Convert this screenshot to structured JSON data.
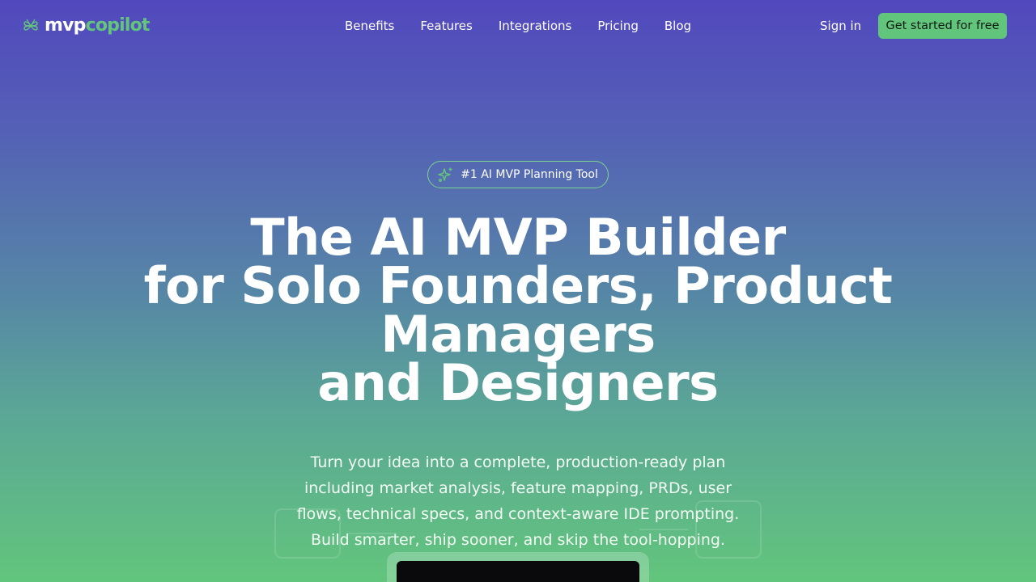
{
  "brand": {
    "name_part1": "mvp",
    "name_part2": "copilot"
  },
  "nav": {
    "links": [
      "Benefits",
      "Features",
      "Integrations",
      "Pricing",
      "Blog"
    ],
    "signin_label": "Sign in",
    "cta_label": "Get started for free"
  },
  "hero": {
    "badge_text": "#1 AI MVP Planning Tool",
    "headline_lines": [
      "The AI MVP Builder",
      "for Solo Founders, Product",
      "Managers",
      "and Designers"
    ],
    "subtext_lines": [
      "Turn your idea into a complete, production-ready plan",
      "including market analysis, feature mapping, PRDs, user",
      "flows, technical specs, and context-aware IDE prompting.",
      "Build smarter, ship sooner, and skip the tool-hopping."
    ]
  },
  "icons": {
    "logo": "clover-logo-icon",
    "badge": "sparkles-icon"
  },
  "colors": {
    "accent_green": "#62c57c",
    "gradient_top": "#5248bd",
    "gradient_bottom": "#62c57c"
  }
}
